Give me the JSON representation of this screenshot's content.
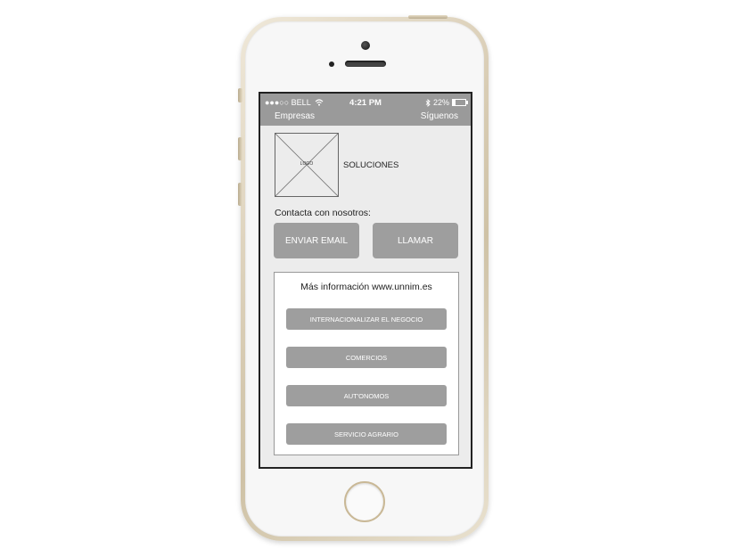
{
  "status_bar": {
    "carrier": "●●●○○ BELL",
    "wifi_icon": "wifi-icon",
    "time": "4:21 PM",
    "bluetooth_icon": "bluetooth-icon",
    "battery": "22%"
  },
  "nav": {
    "left_label": "Empresas",
    "right_label": "Síguenos"
  },
  "logo": {
    "label": "LOGO",
    "company": "SOLUCIONES"
  },
  "contact": {
    "label": "Contacta con nosotros:",
    "email_button": "ENVIAR EMAIL",
    "call_button": "LLAMAR"
  },
  "info": {
    "title": "Más información www.unnim.es",
    "buttons": [
      "INTERNACIONALIZAR EL NEGOCIO",
      "COMERCIOS",
      "AUT'ONOMOS",
      "SERVICIO AGRARIO"
    ]
  },
  "colors": {
    "bar": "#9a9a9a",
    "button": "#9e9e9e",
    "screen_bg": "#ececec"
  }
}
